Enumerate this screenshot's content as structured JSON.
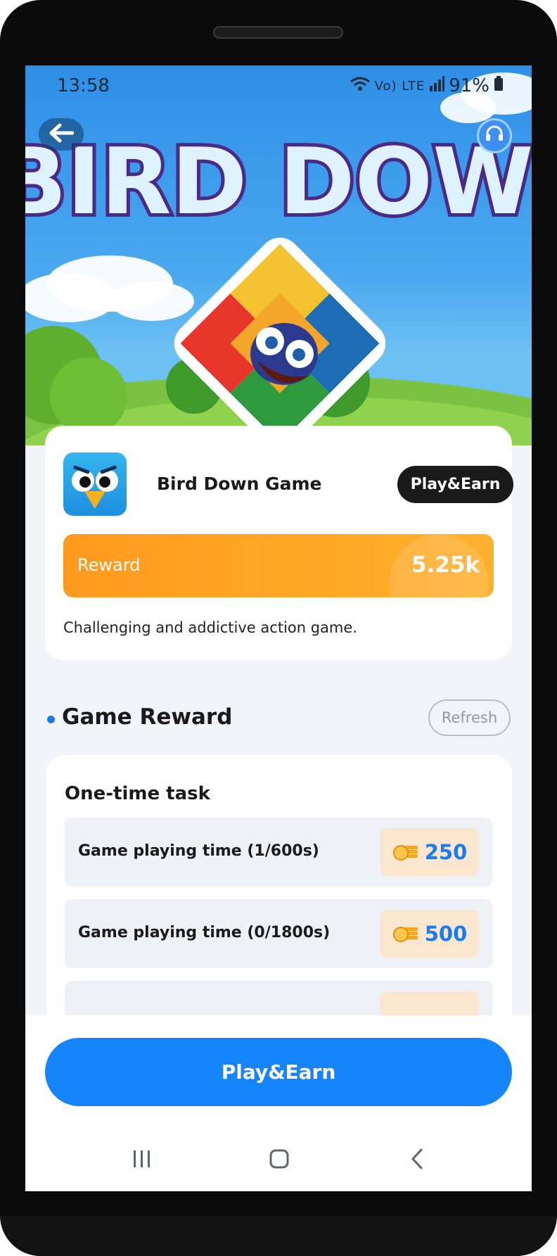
{
  "status_bar": {
    "time": "13:58",
    "battery": "91%",
    "icons": "Vo) LTE"
  },
  "hero": {
    "banner_text": "BIRD DOWN"
  },
  "game": {
    "name": "Bird Down Game",
    "tag": "Play&Earn",
    "reward_label": "Reward",
    "reward_value": "5.25k",
    "description": "Challenging and addictive action game."
  },
  "game_reward": {
    "title": "Game Reward",
    "refresh_label": "Refresh",
    "section_title": "One-time task",
    "tasks": [
      {
        "label": "Game playing time (1/600s)",
        "amount": "250"
      },
      {
        "label": "Game playing time (0/1800s)",
        "amount": "500"
      },
      {
        "label": "",
        "amount": ""
      }
    ]
  },
  "cta": {
    "label": "Play&Earn"
  },
  "colors": {
    "primary": "#1684fb",
    "reward": "#ffa528",
    "pill": "#fbe7cf"
  }
}
